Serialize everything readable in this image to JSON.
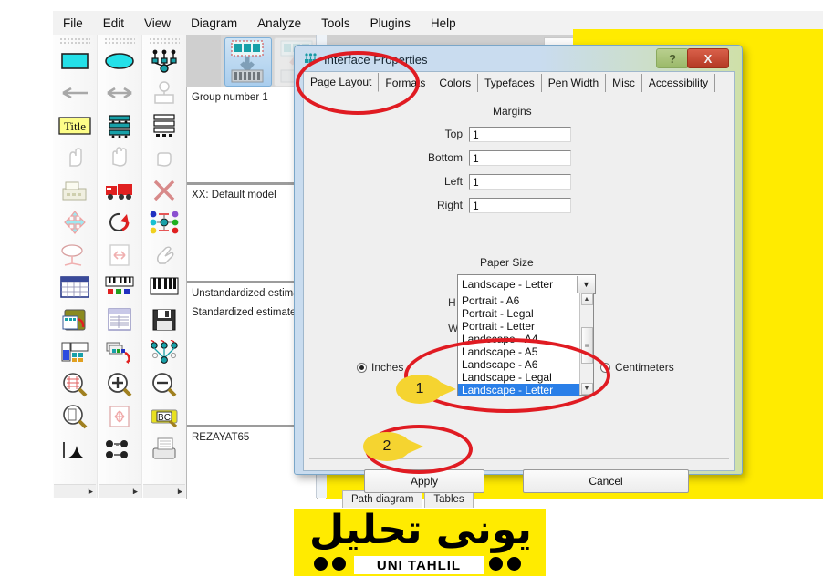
{
  "menubar": {
    "items": [
      "File",
      "Edit",
      "View",
      "Diagram",
      "Analyze",
      "Tools",
      "Plugins",
      "Help"
    ]
  },
  "toolbox": {
    "columns": [
      {
        "tools": [
          {
            "name": "draw-rectangle-icon"
          },
          {
            "name": "arrow-left-icon"
          },
          {
            "name": "figure-caption-title-icon",
            "label": "Title"
          },
          {
            "name": "pointing-hand-icon"
          },
          {
            "name": "scanner-icon"
          },
          {
            "name": "move-objects-icon"
          },
          {
            "name": "rotate-indicator-icon"
          },
          {
            "name": "spreadsheet-icon"
          },
          {
            "name": "copy-to-clipboard-icon"
          },
          {
            "name": "analysis-properties-icon"
          },
          {
            "name": "magnify-diagram-icon"
          },
          {
            "name": "preview-page-icon"
          },
          {
            "name": "distribution-curve-icon"
          }
        ]
      },
      {
        "tools": [
          {
            "name": "draw-ellipse-icon"
          },
          {
            "name": "double-arrow-icon"
          },
          {
            "name": "list-variables-dataset-icon"
          },
          {
            "name": "grab-hand-icon"
          },
          {
            "name": "fire-truck-icon"
          },
          {
            "name": "rotate-arrow-icon"
          },
          {
            "name": "resize-page-icon"
          },
          {
            "name": "piano-keys-icon"
          },
          {
            "name": "view-text-output-icon"
          },
          {
            "name": "duplicate-objects-icon"
          },
          {
            "name": "zoom-in-icon"
          },
          {
            "name": "move-page-icon"
          },
          {
            "name": "multiple-group-icon"
          }
        ]
      },
      {
        "tools": [
          {
            "name": "path-diagram-node-icon"
          },
          {
            "name": "latent-variable-icon"
          },
          {
            "name": "list-variables-model-icon"
          },
          {
            "name": "closed-hand-icon"
          },
          {
            "name": "delete-object-icon"
          },
          {
            "name": "degrees-of-freedom-icon"
          },
          {
            "name": "select-all-icon"
          },
          {
            "name": "piano-keys-alt-icon"
          },
          {
            "name": "save-diagram-icon"
          },
          {
            "name": "model-fit-icon"
          },
          {
            "name": "zoom-out-icon"
          },
          {
            "name": "bayesian-estimation-icon"
          },
          {
            "name": "print-icon"
          }
        ]
      }
    ],
    "scroll_glyph": "I▸"
  },
  "model_toolbar": {
    "unstandardized_button": "model-estimates-down-icon",
    "standardized_button": "model-estimates-up-icon"
  },
  "panels": [
    {
      "name": "group-panel",
      "lines": [
        "Group number 1"
      ]
    },
    {
      "name": "model-panel",
      "lines": [
        "XX: Default model"
      ]
    },
    {
      "name": "estimates-panel",
      "lines": [
        "Unstandardized estimat",
        "Standardized estimates"
      ]
    },
    {
      "name": "file-panel",
      "lines": [
        "REZAYAT65"
      ]
    }
  ],
  "bottom_tabs": [
    {
      "label": "Path diagram"
    },
    {
      "label": "Tables"
    }
  ],
  "dialog": {
    "title": "Interface Properties",
    "icon": "interface-properties-icon",
    "help_button": "?",
    "close_button": "X",
    "tabs": [
      {
        "label": "Page Layout",
        "active": true
      },
      {
        "label": "Formats",
        "active": false
      },
      {
        "label": "Colors",
        "active": false
      },
      {
        "label": "Typefaces",
        "active": false
      },
      {
        "label": "Pen Width",
        "active": false
      },
      {
        "label": "Misc",
        "active": false
      },
      {
        "label": "Accessibility",
        "active": false
      }
    ],
    "margins": {
      "heading": "Margins",
      "fields": [
        {
          "label": "Top",
          "value": "1"
        },
        {
          "label": "Bottom",
          "value": "1"
        },
        {
          "label": "Left",
          "value": "1"
        },
        {
          "label": "Right",
          "value": "1"
        }
      ]
    },
    "hidden_labels": {
      "height": "H",
      "width": "W"
    },
    "paper_size": {
      "heading": "Paper Size",
      "selected": "Landscape - Letter",
      "dropdown_arrow": "▼",
      "options": [
        {
          "label": "Portrait - A6",
          "selected": false
        },
        {
          "label": "Portrait - Legal",
          "selected": false
        },
        {
          "label": "Portrait - Letter",
          "selected": false
        },
        {
          "label": "Landscape - A4",
          "selected": false
        },
        {
          "label": "Landscape - A5",
          "selected": false
        },
        {
          "label": "Landscape - A6",
          "selected": false
        },
        {
          "label": "Landscape - Legal",
          "selected": false
        },
        {
          "label": "Landscape - Letter",
          "selected": true
        }
      ],
      "scroll_up": "▲",
      "scroll_down": "▼",
      "scroll_grip": "≡"
    },
    "units": {
      "inches": {
        "label": "Inches",
        "selected": true
      },
      "centimeters": {
        "label": "Centimeters",
        "selected": false
      }
    },
    "buttons": {
      "apply": "Apply",
      "cancel": "Cancel"
    }
  },
  "annotations": {
    "callouts": [
      {
        "number": "1",
        "target": "paper-size-list"
      },
      {
        "number": "2",
        "target": "apply-button"
      }
    ],
    "highlight_color": "#e01b22",
    "callout_color": "#f5d430",
    "band_color": "#ffeb00"
  },
  "watermark": {
    "farsi": "یونی تحلیل",
    "english": "UNI TAHLIL"
  }
}
